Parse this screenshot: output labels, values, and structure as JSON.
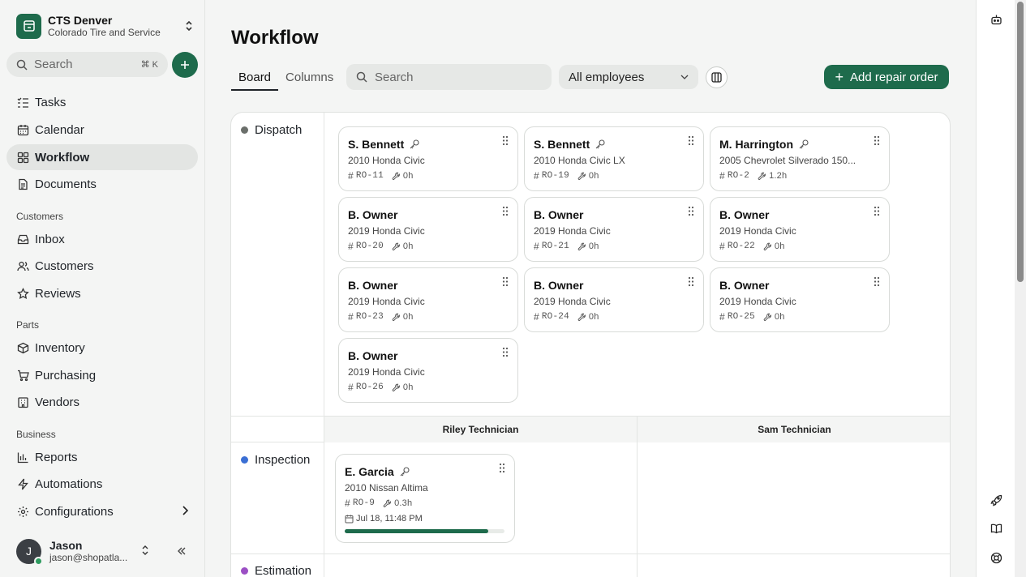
{
  "org": {
    "name": "CTS Denver",
    "subtitle": "Colorado Tire and Service"
  },
  "sidebar": {
    "search_placeholder": "Search",
    "search_shortcut": "⌘ K",
    "items": [
      {
        "label": "Tasks"
      },
      {
        "label": "Calendar"
      },
      {
        "label": "Workflow"
      },
      {
        "label": "Documents"
      },
      {
        "label": "Inbox"
      },
      {
        "label": "Customers"
      },
      {
        "label": "Reviews"
      },
      {
        "label": "Inventory"
      },
      {
        "label": "Purchasing"
      },
      {
        "label": "Vendors"
      },
      {
        "label": "Reports"
      },
      {
        "label": "Automations"
      },
      {
        "label": "Configurations"
      }
    ],
    "sections": {
      "customers": "Customers",
      "parts": "Parts",
      "business": "Business"
    },
    "user": {
      "initial": "J",
      "name": "Jason",
      "email": "jason@shopatla..."
    }
  },
  "main": {
    "title": "Workflow",
    "tabs": [
      {
        "label": "Board"
      },
      {
        "label": "Columns"
      }
    ],
    "search_placeholder": "Search",
    "employee_filter": "All employees",
    "add_button": "Add repair order"
  },
  "board": {
    "stages": [
      {
        "label": "Dispatch",
        "color": "#6b6f6b"
      },
      {
        "label": "Inspection",
        "color": "#3b6fd4"
      },
      {
        "label": "Estimation",
        "color": "#9b4fc4"
      }
    ],
    "technicians": [
      "Riley Technician",
      "Sam Technician"
    ],
    "dispatch_cards": [
      {
        "customer": "S. Bennett",
        "vehicle": "2010 Honda Civic",
        "ro": "RO-11",
        "hours": "0h"
      },
      {
        "customer": "S. Bennett",
        "vehicle": "2010 Honda Civic LX",
        "ro": "RO-19",
        "hours": "0h"
      },
      {
        "customer": "M. Harrington",
        "vehicle": "2005 Chevrolet Silverado 150...",
        "ro": "RO-2",
        "hours": "1.2h"
      },
      {
        "customer": "B. Owner",
        "vehicle": "2019 Honda Civic",
        "ro": "RO-20",
        "hours": "0h"
      },
      {
        "customer": "B. Owner",
        "vehicle": "2019 Honda Civic",
        "ro": "RO-21",
        "hours": "0h"
      },
      {
        "customer": "B. Owner",
        "vehicle": "2019 Honda Civic",
        "ro": "RO-22",
        "hours": "0h"
      },
      {
        "customer": "B. Owner",
        "vehicle": "2019 Honda Civic",
        "ro": "RO-23",
        "hours": "0h"
      },
      {
        "customer": "B. Owner",
        "vehicle": "2019 Honda Civic",
        "ro": "RO-24",
        "hours": "0h"
      },
      {
        "customer": "B. Owner",
        "vehicle": "2019 Honda Civic",
        "ro": "RO-25",
        "hours": "0h"
      },
      {
        "customer": "B. Owner",
        "vehicle": "2019 Honda Civic",
        "ro": "RO-26",
        "hours": "0h"
      }
    ],
    "inspection_card": {
      "customer": "E. Garcia",
      "vehicle": "2010 Nissan Altima",
      "ro": "RO-9",
      "hours": "0.3h",
      "date": "Jul 18, 11:48 PM",
      "progress_percent": 90
    }
  },
  "colors": {
    "brand": "#1e6b4c"
  }
}
